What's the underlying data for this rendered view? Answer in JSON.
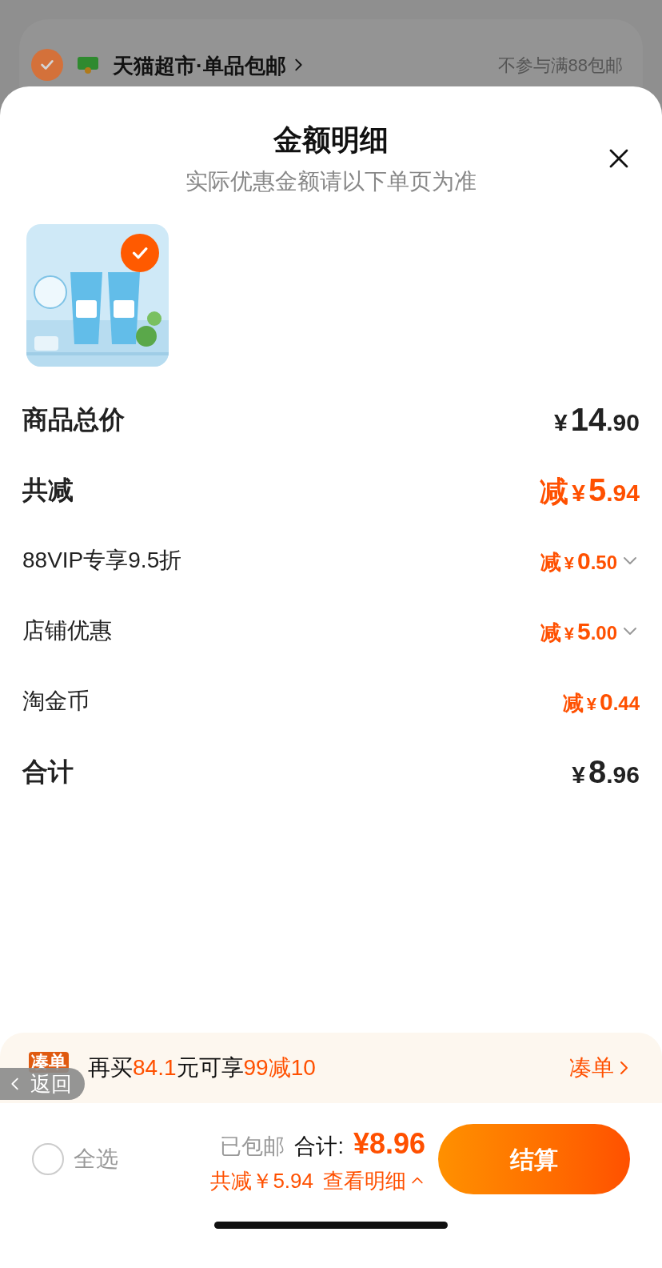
{
  "background_store": {
    "checked": true,
    "store_name": "天猫超市·单品包邮",
    "note": "不参与满88包邮"
  },
  "sheet": {
    "title": "金额明细",
    "subtitle": "实际优惠金额请以下单页为准",
    "products": [
      {
        "kind": "picture",
        "selected": true
      }
    ],
    "rows": [
      {
        "kind": "total",
        "label": "商品总价",
        "prefix": "",
        "currency": "¥",
        "integer": "14",
        "fraction": ".90",
        "expandable": false
      },
      {
        "kind": "discount",
        "label": "共减",
        "prefix": "减",
        "currency": "¥",
        "integer": "5",
        "fraction": ".94",
        "expandable": false
      },
      {
        "kind": "item",
        "label": "88VIP专享9.5折",
        "prefix": "减",
        "currency": "¥",
        "integer": "0",
        "fraction": ".50",
        "expandable": true
      },
      {
        "kind": "item",
        "label": "店铺优惠",
        "prefix": "减",
        "currency": "¥",
        "integer": "5",
        "fraction": ".00",
        "expandable": true
      },
      {
        "kind": "item",
        "label": "淘金币",
        "prefix": "减",
        "currency": "¥",
        "integer": "0",
        "fraction": ".44",
        "expandable": false
      },
      {
        "kind": "total",
        "label": "合计",
        "prefix": "",
        "currency": "¥",
        "integer": "8",
        "fraction": ".96",
        "expandable": false
      }
    ]
  },
  "promo_bar": {
    "badge": "凑单",
    "segments": [
      {
        "text": "再买",
        "highlight": false
      },
      {
        "text": "84.1",
        "highlight": true
      },
      {
        "text": "元可享",
        "highlight": false
      },
      {
        "text": "99减10",
        "highlight": true
      }
    ],
    "link": "凑单"
  },
  "back_button": {
    "label": "返回"
  },
  "checkout_bar": {
    "select_all": {
      "label": "全选",
      "checked": false
    },
    "shipping": "已包邮",
    "total_label": "合计:",
    "total": "¥8.96",
    "saved": "共减￥5.94",
    "details_link": "查看明细",
    "button": "结算"
  }
}
